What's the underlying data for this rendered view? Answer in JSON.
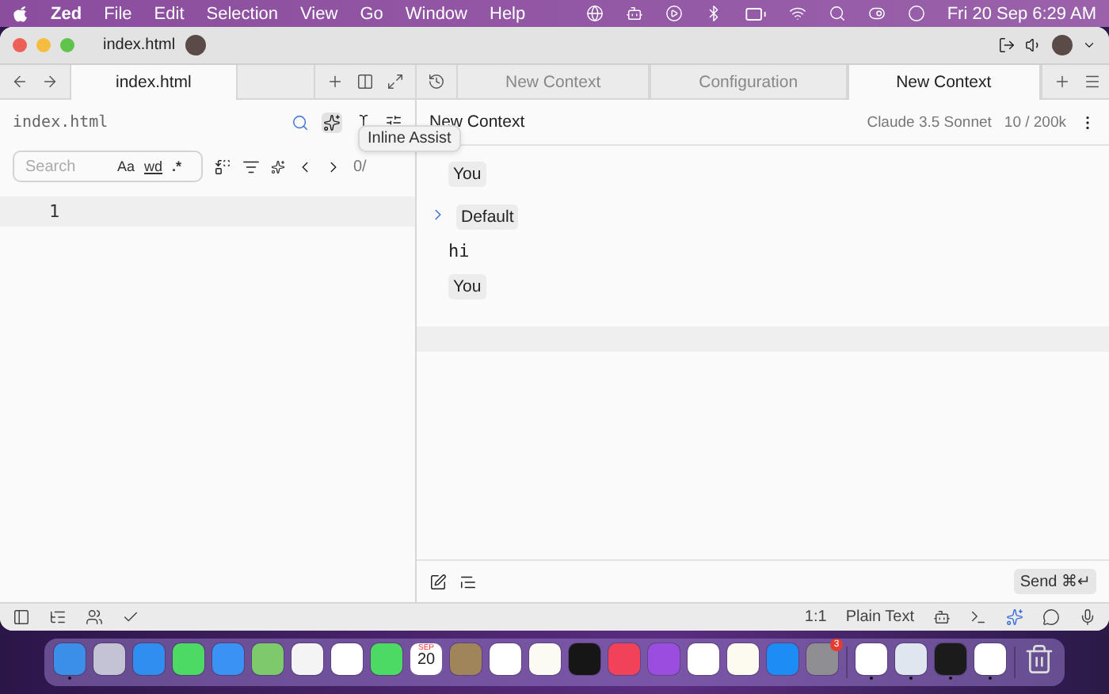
{
  "menubar": {
    "items": [
      "Zed",
      "File",
      "Edit",
      "Selection",
      "View",
      "Go",
      "Window",
      "Help"
    ],
    "clock": "Fri 20 Sep  6:29 AM"
  },
  "window": {
    "title": "index.html"
  },
  "left_tabs": [
    {
      "label": "index.html",
      "selected": true
    }
  ],
  "editor": {
    "breadcrumb": "index.html",
    "search": {
      "placeholder": "Search",
      "case_toggle": "Aa",
      "word_toggle": "wd",
      "regex_toggle": ".*",
      "matches": "0/"
    },
    "line_numbers": [
      "1"
    ]
  },
  "tooltip": "Inline Assist",
  "right_tabs": [
    {
      "label": "New Context",
      "selected": false
    },
    {
      "label": "Configuration",
      "selected": false
    },
    {
      "label": "New Context",
      "selected": true
    }
  ],
  "context": {
    "title": "New Context",
    "model": "Claude 3.5 Sonnet",
    "tokens": "10 / 200k",
    "messages": [
      {
        "kind": "role",
        "label": "You"
      },
      {
        "kind": "prompt",
        "label": "Default",
        "expanded": false
      },
      {
        "kind": "text",
        "text": "hi"
      },
      {
        "kind": "role",
        "label": "You"
      }
    ],
    "send": {
      "label": "Send",
      "shortcut": "⌘↵"
    }
  },
  "status_bar": {
    "position": "1:1",
    "language": "Plain Text"
  },
  "dock": [
    {
      "kind": "app",
      "color": "#3b8fe8",
      "running": true
    },
    {
      "kind": "app",
      "color": "#c4c3d6",
      "running": false
    },
    {
      "kind": "app",
      "color": "#2f8ef0",
      "running": false
    },
    {
      "kind": "app",
      "color": "#4cd964",
      "running": false
    },
    {
      "kind": "app",
      "color": "#3a93f4",
      "running": false
    },
    {
      "kind": "app",
      "color": "#7dc96b",
      "running": false
    },
    {
      "kind": "app",
      "color": "#f4f4f4",
      "running": false
    },
    {
      "kind": "app",
      "color": "#ffffff",
      "running": false
    },
    {
      "kind": "app",
      "color": "#4cd964",
      "running": false
    },
    {
      "kind": "calendar",
      "month": "SEP",
      "day": "20",
      "running": false
    },
    {
      "kind": "app",
      "color": "#a0855b",
      "running": false
    },
    {
      "kind": "app",
      "color": "#ffffff",
      "running": false
    },
    {
      "kind": "app",
      "color": "#fbfbf4",
      "running": false
    },
    {
      "kind": "app",
      "color": "#161616",
      "running": false
    },
    {
      "kind": "app",
      "color": "#f0435a",
      "running": false
    },
    {
      "kind": "app",
      "color": "#9b4de0",
      "running": false
    },
    {
      "kind": "app",
      "color": "#ffffff",
      "running": false
    },
    {
      "kind": "app",
      "color": "#fdfaf0",
      "running": false
    },
    {
      "kind": "app",
      "color": "#1d8cf5",
      "running": false
    },
    {
      "kind": "app",
      "color": "#8e8e93",
      "running": false,
      "badge": "3"
    },
    {
      "kind": "separator"
    },
    {
      "kind": "app",
      "color": "#ffffff",
      "running": true
    },
    {
      "kind": "app",
      "color": "#dfe6f0",
      "running": true
    },
    {
      "kind": "app",
      "color": "#1b1b1b",
      "running": true
    },
    {
      "kind": "app",
      "color": "#ffffff",
      "running": true
    },
    {
      "kind": "separator"
    },
    {
      "kind": "trash"
    }
  ]
}
